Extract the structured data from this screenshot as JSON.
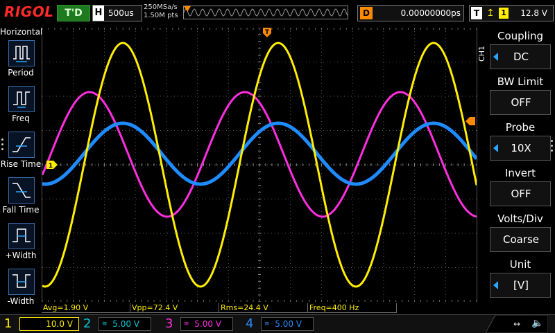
{
  "top": {
    "logo": "RIGOL",
    "run_status": "T'D",
    "timebase_letter": "H",
    "timebase": "500us",
    "sample_rate": "250MSa/s",
    "memory_points": "1.50M pts",
    "delay_letter": "D",
    "delay": "0.00000000ps",
    "trigger_letter": "T",
    "trigger_source": "1",
    "trigger_level": "12.8 V"
  },
  "left_menu": {
    "title": "Horizontal",
    "items": [
      {
        "label": "Period",
        "icon": "period-icon"
      },
      {
        "label": "Freq",
        "icon": "frequency-icon"
      },
      {
        "label": "Rise Time",
        "icon": "rise-time-icon"
      },
      {
        "label": "Fall Time",
        "icon": "fall-time-icon"
      },
      {
        "label": "+Width",
        "icon": "positive-width-icon"
      },
      {
        "label": "-Width",
        "icon": "negative-width-icon"
      }
    ]
  },
  "right_menu": {
    "channel_tag": "CH1",
    "items": [
      {
        "title": "Coupling",
        "value": "DC",
        "arrow": true
      },
      {
        "title": "BW Limit",
        "value": "OFF",
        "arrow": false
      },
      {
        "title": "Probe",
        "value": "10X",
        "arrow": true
      },
      {
        "title": "Invert",
        "value": "OFF",
        "arrow": false
      },
      {
        "title": "Volts/Div",
        "value": "Coarse",
        "arrow": false
      },
      {
        "title": "Unit",
        "value": "[V]",
        "arrow": true
      }
    ]
  },
  "measurements": {
    "avg": "Avg=1.90 V",
    "vpp": "Vpp=72.4 V",
    "rms": "Rms=24.4 V",
    "freq": "Freq=400 Hz"
  },
  "channels": [
    {
      "num": "1",
      "scale": "10.0 V",
      "color": "#ffee00"
    },
    {
      "num": "2",
      "scale": "5.00 V",
      "color": "#00c8d8"
    },
    {
      "num": "3",
      "scale": "5.00 V",
      "color": "#ff2ee0"
    },
    {
      "num": "4",
      "scale": "5.00 V",
      "color": "#2a8cff"
    }
  ],
  "markers": {
    "trigger_pos": "T",
    "ch1_ground": "1"
  },
  "colors": {
    "ch1": "#ffee00",
    "ch3": "#ff2ee0",
    "ch4": "#1e8cff",
    "grid": "#5a5a5a",
    "trigger_marker": "#ff8a00",
    "menu_arrow": "#2aa6ff"
  }
}
